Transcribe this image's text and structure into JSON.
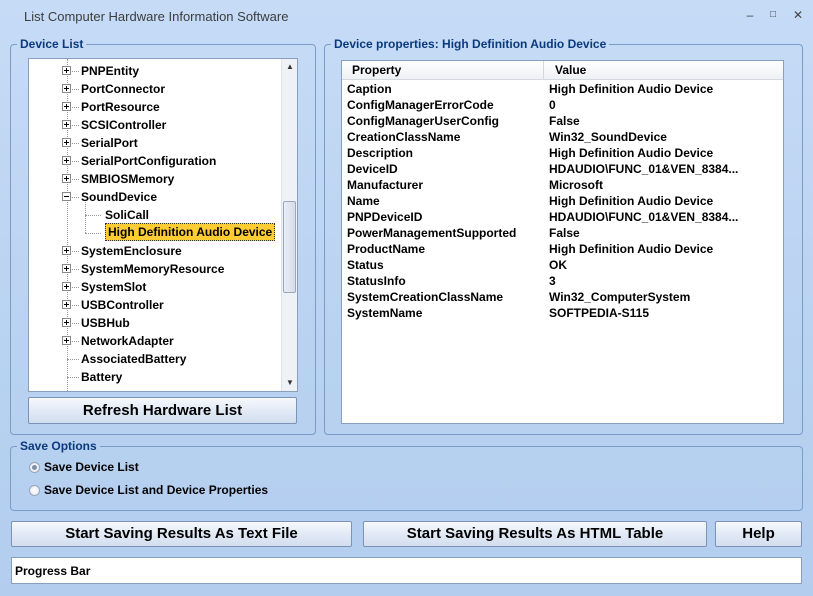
{
  "window": {
    "title": "List Computer Hardware Information Software",
    "minimize": "–",
    "maximize": "□",
    "close": "✕"
  },
  "device_list": {
    "legend": "Device List",
    "items": [
      {
        "label": "PNPEntity",
        "expander": "plus"
      },
      {
        "label": "PortConnector",
        "expander": "plus"
      },
      {
        "label": "PortResource",
        "expander": "plus"
      },
      {
        "label": "SCSIController",
        "expander": "plus"
      },
      {
        "label": "SerialPort",
        "expander": "plus"
      },
      {
        "label": "SerialPortConfiguration",
        "expander": "plus"
      },
      {
        "label": "SMBIOSMemory",
        "expander": "plus"
      },
      {
        "label": "SoundDevice",
        "expander": "minus"
      },
      {
        "label": "SoliCall",
        "expander": "child"
      },
      {
        "label": "High Definition Audio Device",
        "expander": "child-selected"
      },
      {
        "label": "SystemEnclosure",
        "expander": "plus"
      },
      {
        "label": "SystemMemoryResource",
        "expander": "plus"
      },
      {
        "label": "SystemSlot",
        "expander": "plus"
      },
      {
        "label": "USBController",
        "expander": "plus"
      },
      {
        "label": "USBHub",
        "expander": "plus"
      },
      {
        "label": "NetworkAdapter",
        "expander": "plus"
      },
      {
        "label": "AssociatedBattery",
        "expander": "none"
      },
      {
        "label": "Battery",
        "expander": "none"
      }
    ],
    "refresh_label": "Refresh Hardware List"
  },
  "properties": {
    "legend": "Device properties: High Definition Audio Device",
    "col_property": "Property",
    "col_value": "Value",
    "rows": [
      {
        "k": "Caption",
        "v": "High Definition Audio Device"
      },
      {
        "k": "ConfigManagerErrorCode",
        "v": "0"
      },
      {
        "k": "ConfigManagerUserConfig",
        "v": "False"
      },
      {
        "k": "CreationClassName",
        "v": "Win32_SoundDevice"
      },
      {
        "k": "Description",
        "v": "High Definition Audio Device"
      },
      {
        "k": "DeviceID",
        "v": "HDAUDIO\\FUNC_01&VEN_8384..."
      },
      {
        "k": "Manufacturer",
        "v": "Microsoft"
      },
      {
        "k": "Name",
        "v": "High Definition Audio Device"
      },
      {
        "k": "PNPDeviceID",
        "v": "HDAUDIO\\FUNC_01&VEN_8384..."
      },
      {
        "k": "PowerManagementSupported",
        "v": "False"
      },
      {
        "k": "ProductName",
        "v": "High Definition Audio Device"
      },
      {
        "k": "Status",
        "v": "OK"
      },
      {
        "k": "StatusInfo",
        "v": "3"
      },
      {
        "k": "SystemCreationClassName",
        "v": "Win32_ComputerSystem"
      },
      {
        "k": "SystemName",
        "v": "SOFTPEDIA-S115"
      }
    ]
  },
  "save_options": {
    "legend": "Save Options",
    "option1": "Save Device List",
    "option2": "Save Device List and Device Properties",
    "selected": 1
  },
  "actions": {
    "save_text": "Start Saving Results As Text File",
    "save_html": "Start Saving Results As HTML Table",
    "help": "Help"
  },
  "progress": {
    "label": "Progress Bar"
  }
}
